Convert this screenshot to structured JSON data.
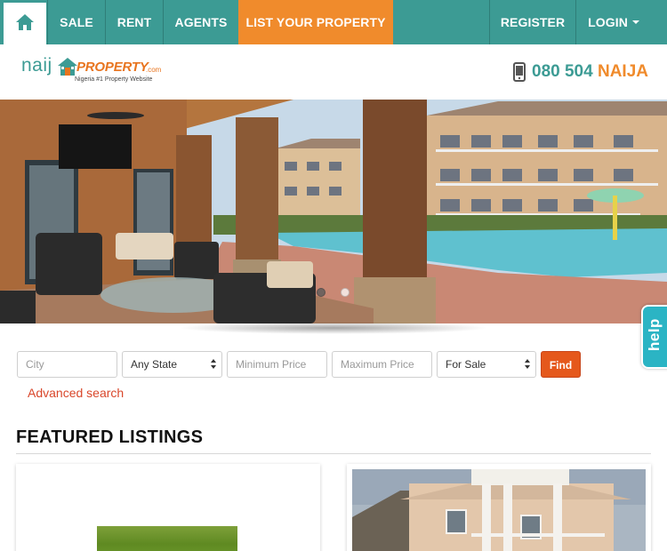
{
  "nav": {
    "home_icon": "home-icon",
    "items": [
      {
        "label": "SALE"
      },
      {
        "label": "RENT"
      },
      {
        "label": "AGENTS"
      },
      {
        "label": "LIST YOUR PROPERTY"
      }
    ],
    "register_label": "REGISTER",
    "login_label": "LOGIN"
  },
  "brand": {
    "logo_naij": "naij",
    "logo_property": "PROPERTY",
    "logo_com": ".com",
    "tagline": "Nigeria #1 Property Website",
    "phone_number": "080 504",
    "phone_word": "NAIJA"
  },
  "search": {
    "city_placeholder": "City",
    "state_selected": "Any State",
    "min_price_placeholder": "Minimum Price",
    "max_price_placeholder": "Maximum Price",
    "type_selected": "For Sale",
    "find_label": "Find",
    "advanced_label": "Advanced search"
  },
  "help": {
    "label": "help"
  },
  "featured": {
    "title": "FEATURED LISTINGS"
  },
  "colors": {
    "teal": "#3c9b94",
    "orange": "#f08b2c",
    "find_red": "#e5581c",
    "help_blue": "#2bb4c4"
  }
}
